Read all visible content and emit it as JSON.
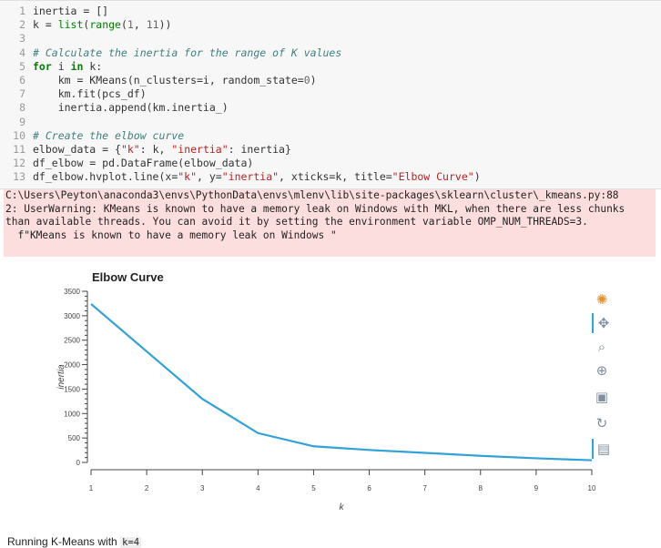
{
  "code_lines": [
    {
      "n": "1",
      "tokens": [
        {
          "t": "inertia = []",
          "c": ""
        }
      ]
    },
    {
      "n": "2",
      "tokens": [
        {
          "t": "k = ",
          "c": ""
        },
        {
          "t": "list",
          "c": "bi"
        },
        {
          "t": "(",
          "c": ""
        },
        {
          "t": "range",
          "c": "bi"
        },
        {
          "t": "(",
          "c": ""
        },
        {
          "t": "1",
          "c": "nb"
        },
        {
          "t": ", ",
          "c": ""
        },
        {
          "t": "11",
          "c": "nb"
        },
        {
          "t": "))",
          "c": ""
        }
      ]
    },
    {
      "n": "3",
      "tokens": []
    },
    {
      "n": "4",
      "tokens": [
        {
          "t": "# Calculate the inertia for the range of K values",
          "c": "cm"
        }
      ]
    },
    {
      "n": "5",
      "tokens": [
        {
          "t": "for",
          "c": "kw"
        },
        {
          "t": " i ",
          "c": ""
        },
        {
          "t": "in",
          "c": "kw"
        },
        {
          "t": " k:",
          "c": ""
        }
      ]
    },
    {
      "n": "6",
      "tokens": [
        {
          "t": "    km = KMeans(n_clusters=i, random_state=",
          "c": ""
        },
        {
          "t": "0",
          "c": "nb"
        },
        {
          "t": ")",
          "c": ""
        }
      ]
    },
    {
      "n": "7",
      "tokens": [
        {
          "t": "    km.fit(pcs_df)",
          "c": ""
        }
      ]
    },
    {
      "n": "8",
      "tokens": [
        {
          "t": "    inertia.append(km.inertia_)",
          "c": ""
        }
      ]
    },
    {
      "n": "9",
      "tokens": []
    },
    {
      "n": "10",
      "tokens": [
        {
          "t": "# Create the elbow curve",
          "c": "cm"
        }
      ]
    },
    {
      "n": "11",
      "tokens": [
        {
          "t": "elbow_data = {",
          "c": ""
        },
        {
          "t": "\"k\"",
          "c": "st"
        },
        {
          "t": ": k, ",
          "c": ""
        },
        {
          "t": "\"inertia\"",
          "c": "st"
        },
        {
          "t": ": inertia}",
          "c": ""
        }
      ]
    },
    {
      "n": "12",
      "tokens": [
        {
          "t": "df_elbow = pd.DataFrame(elbow_data)",
          "c": ""
        }
      ]
    },
    {
      "n": "13",
      "tokens": [
        {
          "t": "df_elbow.hvplot.line(x=",
          "c": ""
        },
        {
          "t": "\"k\"",
          "c": "st"
        },
        {
          "t": ", y=",
          "c": ""
        },
        {
          "t": "\"inertia\"",
          "c": "st"
        },
        {
          "t": ", xticks=k, title=",
          "c": ""
        },
        {
          "t": "\"Elbow Curve\"",
          "c": "st"
        },
        {
          "t": ")",
          "c": ""
        }
      ]
    }
  ],
  "stderr_lines": [
    "C:\\Users\\Peyton\\anaconda3\\envs\\PythonData\\envs\\mlenv\\lib\\site-packages\\sklearn\\cluster\\_kmeans.py:88",
    "2: UserWarning: KMeans is known to have a memory leak on Windows with MKL, when there are less chunks",
    "than available threads. You can avoid it by setting the environment variable OMP_NUM_THREADS=3.",
    "  f\"KMeans is known to have a memory leak on Windows \""
  ],
  "chart_data": {
    "type": "line",
    "title": "Elbow Curve",
    "xlabel": "k",
    "ylabel": "inertia",
    "x": [
      1,
      2,
      3,
      4,
      5,
      6,
      7,
      8,
      9,
      10
    ],
    "y": [
      3240,
      2270,
      1300,
      600,
      330,
      255,
      195,
      135,
      85,
      45
    ],
    "xlim": [
      1,
      10
    ],
    "ylim": [
      0,
      3500
    ],
    "yticks": [
      0,
      500,
      1000,
      1500,
      2000,
      2500,
      3000,
      3500
    ],
    "xticks": [
      1,
      2,
      3,
      4,
      5,
      6,
      7,
      8,
      9,
      10
    ],
    "line_color": "#30a2da",
    "grid": false
  },
  "toolbar": [
    {
      "name": "bokeh-logo-icon",
      "symbol": "✺"
    },
    {
      "name": "pan-tool-icon",
      "symbol": "✥"
    },
    {
      "name": "box-zoom-tool-icon",
      "symbol": "⌕"
    },
    {
      "name": "wheel-zoom-tool-icon",
      "symbol": "⊕"
    },
    {
      "name": "save-tool-icon",
      "symbol": "▣"
    },
    {
      "name": "reset-tool-icon",
      "symbol": "↻"
    },
    {
      "name": "hover-tool-icon",
      "symbol": "▤"
    }
  ],
  "markdown": {
    "prefix": "Running K-Means with ",
    "code": "k=4"
  }
}
